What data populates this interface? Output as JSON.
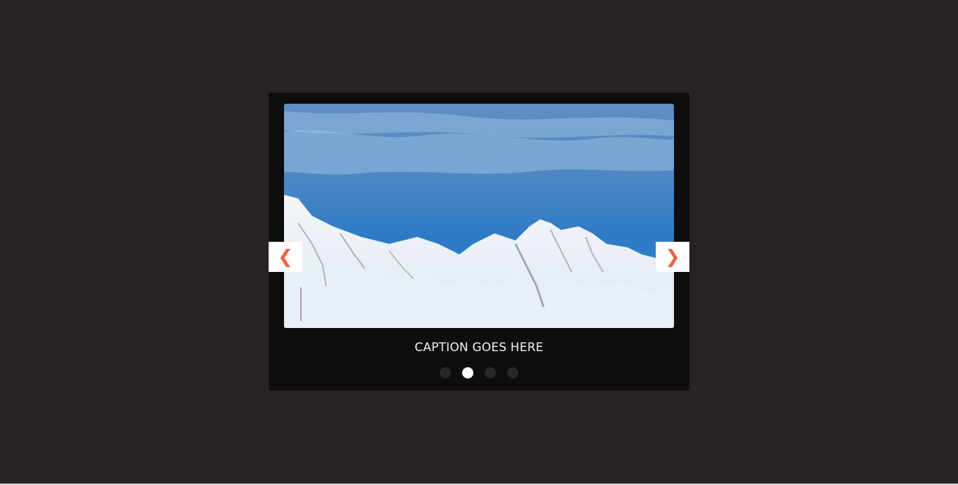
{
  "slider": {
    "caption": "CAPTION GOES HERE",
    "prev_icon": "chevron-left-icon",
    "next_icon": "chevron-right-icon",
    "prev_glyph": "❮",
    "next_glyph": "❯",
    "image_subject": "snow-covered mountain range under blue sky",
    "slide_count": 4,
    "active_slide": 2
  },
  "colors": {
    "page_background": "#282223",
    "slider_background": "#0e0d0d",
    "arrow_background": "#ffffff",
    "arrow_accent": "#f0613f",
    "dot_inactive": "#2b2727",
    "dot_active": "#ffffff"
  }
}
